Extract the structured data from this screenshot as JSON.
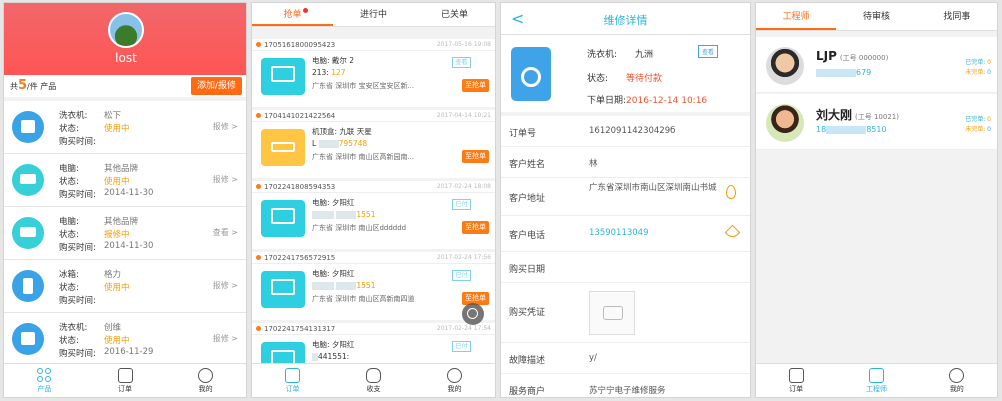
{
  "p1": {
    "username": "lost",
    "count_prefix": "共",
    "count": "5",
    "count_suffix": "/件 产品",
    "add_button": "添加/报修",
    "items": [
      {
        "type_label": "洗衣机:",
        "brand": "松下",
        "status_label": "状态:",
        "status": "使用中",
        "date_label": "购买时间:",
        "date": "",
        "action": "报修 >",
        "icon": "washer-icon"
      },
      {
        "type_label": "电脑:",
        "brand": "其他品牌",
        "status_label": "状态:",
        "status": "使用中",
        "date_label": "购买时间:",
        "date": "2014-11-30",
        "action": "报修 >",
        "icon": "computer-icon"
      },
      {
        "type_label": "电脑:",
        "brand": "其他品牌",
        "status_label": "状态:",
        "status": "报修中",
        "date_label": "购买时间:",
        "date": "2014-11-30",
        "action": "查看 >",
        "icon": "computer-icon"
      },
      {
        "type_label": "冰箱:",
        "brand": "格力",
        "status_label": "状态:",
        "status": "使用中",
        "date_label": "购买时间:",
        "date": "",
        "action": "报修 >",
        "icon": "fridge-icon"
      },
      {
        "type_label": "洗衣机:",
        "brand": "创维",
        "status_label": "状态:",
        "status": "使用中",
        "date_label": "购买时间:",
        "date": "2016-11-29",
        "action": "报修 >",
        "icon": "washer-icon"
      }
    ],
    "tabs": [
      "产品",
      "订单",
      "我的"
    ]
  },
  "p2": {
    "tabs": [
      "抢单",
      "进行中",
      "已关单"
    ],
    "orders": [
      {
        "id": "1705161800095423",
        "date": "2017-05-16 19:08",
        "line1": "电脑:  戴尔 2",
        "line2_prefix": "213:",
        "line2_hl": "127",
        "addr": "广东省 深圳市 宝安区宝安区新...",
        "tag": "查看",
        "button": "至抢单",
        "img": "computer"
      },
      {
        "id": "1704141021422564",
        "date": "2017-04-14 10:21",
        "line1": "机顶盒:  九联 天星",
        "line2_prefix": "L",
        "line2_hl": "795748",
        "addr": "广东省 深圳市 南山区高新园南...",
        "tag": "",
        "button": "至抢单",
        "img": "settop"
      },
      {
        "id": "1702241808594353",
        "date": "2017-02-24 18:08",
        "line1": "电脑:  夕阳红",
        "line2_prefix": "",
        "line2_hl": "1551",
        "addr": "广东省 深圳市 南山区dddddd",
        "tag": "已付",
        "button": "至抢单",
        "img": "computer"
      },
      {
        "id": "1702241756572915",
        "date": "2017-02-24 17:56",
        "line1": "电脑:  夕阳红",
        "line2_prefix": "",
        "line2_hl": "1551",
        "addr": "广东省 深圳市 南山区高新南四道",
        "tag": "已付",
        "button": "至抢单",
        "img": "computer"
      },
      {
        "id": "1702241754131317",
        "date": "2017-02-24 17:54",
        "line1": "电脑:  夕阳红",
        "line2_prefix": "441551:",
        "line2_hl": "",
        "addr": "",
        "tag": "已付",
        "button": "",
        "img": "computer"
      }
    ],
    "bottom_tabs": [
      "订单",
      "收支",
      "我的"
    ]
  },
  "p3": {
    "back": "<",
    "title": "维修详情",
    "device_label": "洗衣机:",
    "device_value": "九洲",
    "brand_tag": "查看",
    "status_label": "状态:",
    "status_value": "等待付款",
    "date_label": "下单日期:",
    "date_value": "2016-12-14 10:16",
    "rows": [
      {
        "label": "订单号",
        "value": "161209114230429б"
      },
      {
        "label": "客户姓名",
        "value": "林"
      },
      {
        "label": "客户地址",
        "value": "广东省深圳市南山区深圳南山书城"
      },
      {
        "label": "客户电话",
        "value": "13590113049"
      },
      {
        "label": "购买日期",
        "value": ""
      },
      {
        "label": "购买凭证",
        "value": ""
      },
      {
        "label": "故障描述",
        "value": "y/"
      },
      {
        "label": "服务商户",
        "value": "苏宁宁电子维修服务"
      }
    ]
  },
  "p4": {
    "tabs": [
      "工程师",
      "待审核",
      "找同事"
    ],
    "engineers": [
      {
        "name": "LJP",
        "id": "(工号 000000)",
        "phone_end": "679",
        "done_label": "已完单:",
        "done": "0",
        "undone_label": "未完单:",
        "undone": "0"
      },
      {
        "name": "刘大刚",
        "id": "(工号 10021)",
        "phone_start": "18",
        "phone_end": "8510",
        "done_label": "已完单:",
        "done": "0",
        "undone_label": "未完单:",
        "undone": "0"
      }
    ],
    "bottom_tabs": [
      "订单",
      "工程师",
      "我的"
    ]
  }
}
